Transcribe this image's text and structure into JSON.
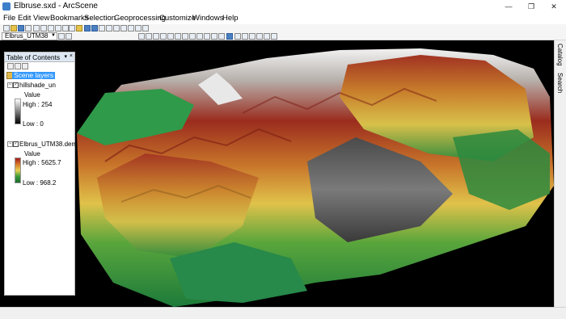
{
  "window": {
    "title": "Elbruse.sxd - ArcScene",
    "min": "—",
    "max": "❐",
    "close": "✕"
  },
  "menu": [
    "File",
    "Edit",
    "View",
    "Bookmarks",
    "Selection",
    "Geoprocessing",
    "Customize",
    "Windows",
    "Help"
  ],
  "toolbar": {
    "layer_combo": "Elbrus_UTM38"
  },
  "toc": {
    "title": "Table of Contents",
    "root": "Scene layers",
    "layers": [
      {
        "name": "hillshade_un",
        "legend_title": "Value",
        "high": "High : 254",
        "low": "Low : 0"
      },
      {
        "name": "Elbrus_UTM38.dem",
        "legend_title": "Value",
        "high": "High : 5625.7",
        "low": "Low : 968.2"
      }
    ]
  },
  "side_tabs": [
    "Catalog",
    "Search"
  ],
  "colors": {
    "accent": "#3399ff",
    "scene_bg": "#000000"
  }
}
